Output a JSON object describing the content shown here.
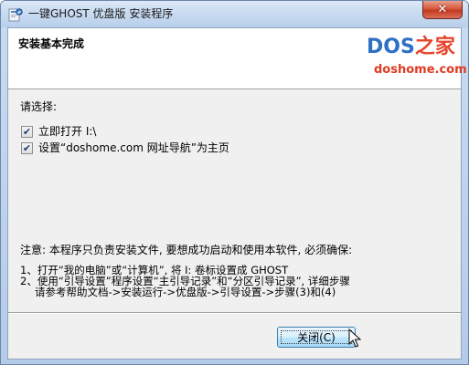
{
  "window": {
    "title": "一键GHOST 优盘版 安装程序",
    "close_glyph": "✕"
  },
  "header": {
    "title": "安装基本完成",
    "logo_dos": "DOS",
    "logo_home": "之家",
    "logo_url": "doshome.com"
  },
  "body": {
    "prompt": "请选择:",
    "options": [
      {
        "label": "立即打开 I:\\",
        "checked": true
      },
      {
        "label": "设置“doshome.com 网址导航”为主页",
        "checked": true
      }
    ],
    "notice": "注意: 本程序只负责安装文件, 要想成功启动和使用本软件, 必须确保:",
    "steps": [
      "1、打开“我的电脑”或“计算机”, 将 I: 卷标设置成 GHOST",
      "2、使用“引导设置”程序设置“主引导记录”和“分区引导记录”, 详细步骤",
      "请参考帮助文档->安装运行->优盘版->引导设置->步骤(3)和(4)"
    ]
  },
  "footer": {
    "close_button_label": "关闭(C)"
  },
  "colors": {
    "logo_blue": "#2f6fc4",
    "logo_red": "#e8432c",
    "close_red": "#c13a1d",
    "button_border": "#3c7fb1"
  },
  "icons": {
    "app": "installer-app-icon",
    "close": "close-icon",
    "check": "checkmark-icon",
    "cursor": "mouse-pointer-icon"
  }
}
